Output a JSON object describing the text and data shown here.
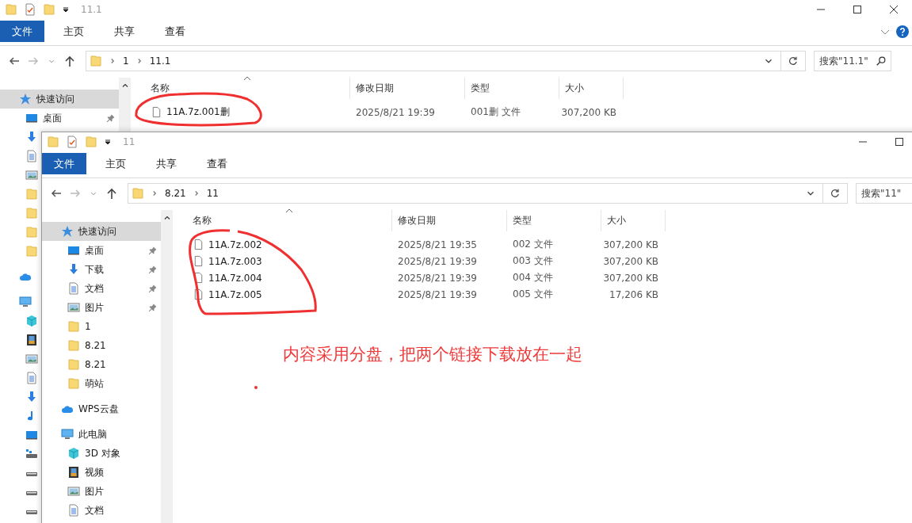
{
  "windows": [
    {
      "title": "11.1",
      "ribbon_tabs": [
        {
          "label": "文件",
          "selected": true
        },
        {
          "label": "主页",
          "selected": false
        },
        {
          "label": "共享",
          "selected": false
        },
        {
          "label": "查看",
          "selected": false
        }
      ],
      "path": [
        "1",
        "11.1"
      ],
      "search": {
        "placeholder": "搜索\"11.1\""
      },
      "sidebar": [
        {
          "label": "快速访问",
          "kind": "star",
          "selected": true,
          "children": [
            {
              "label": "桌面",
              "kind": "monitor",
              "pinned": true
            },
            {
              "kind": "download"
            },
            {
              "kind": "document"
            },
            {
              "kind": "picture"
            },
            {
              "kind": "folder"
            },
            {
              "kind": "folder"
            },
            {
              "kind": "folder"
            },
            {
              "kind": "folder"
            }
          ]
        },
        {
          "kind": "cloud"
        },
        {
          "kind": "computer",
          "children": [
            {
              "kind": "cube"
            },
            {
              "kind": "film"
            },
            {
              "kind": "picture"
            },
            {
              "kind": "document"
            },
            {
              "kind": "download"
            },
            {
              "kind": "music"
            },
            {
              "kind": "monitor"
            },
            {
              "kind": "netdrive"
            },
            {
              "kind": "drive"
            },
            {
              "kind": "drive"
            },
            {
              "kind": "drive"
            }
          ]
        }
      ],
      "columns": [
        "名称",
        "修改日期",
        "类型",
        "大小"
      ],
      "rows": [
        {
          "name": "11A.7z.001删",
          "date": "2025/8/21 19:39",
          "type": "001删 文件",
          "size": "307,200 KB"
        }
      ]
    },
    {
      "title": "11",
      "ribbon_tabs": [
        {
          "label": "文件",
          "selected": true
        },
        {
          "label": "主页",
          "selected": false
        },
        {
          "label": "共享",
          "selected": false
        },
        {
          "label": "查看",
          "selected": false
        }
      ],
      "path": [
        "8.21",
        "11"
      ],
      "search": {
        "placeholder": "搜索\"11\""
      },
      "sidebar": [
        {
          "label": "快速访问",
          "kind": "star",
          "selected": true,
          "children": [
            {
              "label": "桌面",
              "kind": "monitor",
              "pinned": true
            },
            {
              "label": "下载",
              "kind": "download",
              "pinned": true
            },
            {
              "label": "文档",
              "kind": "document",
              "pinned": true
            },
            {
              "label": "图片",
              "kind": "picture",
              "pinned": true
            },
            {
              "label": "1",
              "kind": "folder",
              "pinned": false
            },
            {
              "label": "8.21",
              "kind": "folder",
              "pinned": false
            },
            {
              "label": "8.21",
              "kind": "folder",
              "pinned": false
            },
            {
              "label": "萌站",
              "kind": "folder",
              "pinned": false
            }
          ]
        },
        {
          "label": "WPS云盘",
          "kind": "cloud",
          "selected": false
        },
        {
          "label": "此电脑",
          "kind": "computer",
          "selected": false,
          "children": [
            {
              "label": "3D 对象",
              "kind": "cube"
            },
            {
              "label": "视频",
              "kind": "film"
            },
            {
              "label": "图片",
              "kind": "picture"
            },
            {
              "label": "文档",
              "kind": "document"
            }
          ]
        }
      ],
      "columns": [
        "名称",
        "修改日期",
        "类型",
        "大小"
      ],
      "rows": [
        {
          "name": "11A.7z.002",
          "date": "2025/8/21 19:35",
          "type": "002 文件",
          "size": "307,200 KB"
        },
        {
          "name": "11A.7z.003",
          "date": "2025/8/21 19:39",
          "type": "003 文件",
          "size": "307,200 KB"
        },
        {
          "name": "11A.7z.004",
          "date": "2025/8/21 19:39",
          "type": "004 文件",
          "size": "307,200 KB"
        },
        {
          "name": "11A.7z.005",
          "date": "2025/8/21 19:39",
          "type": "005 文件",
          "size": "17,206 KB"
        }
      ]
    }
  ],
  "annotation": {
    "text": "内容采用分盘，把两个链接下载放在一起"
  }
}
